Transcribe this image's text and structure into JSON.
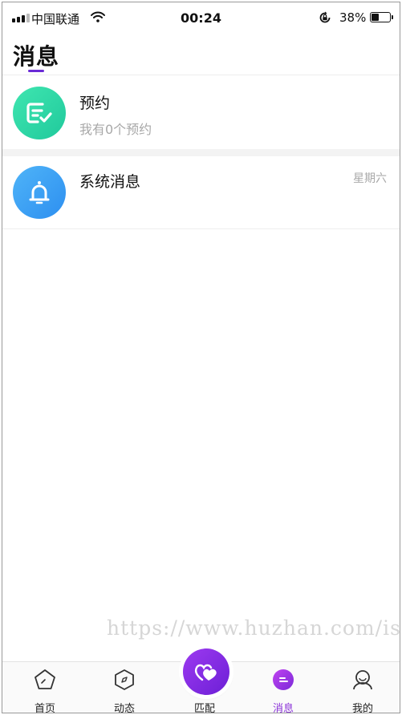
{
  "status_bar": {
    "carrier": "中国联通",
    "time": "00:24",
    "battery_percent": "38%",
    "battery_level": 0.38,
    "icons": [
      "signal-icon",
      "wifi-icon",
      "rotation-lock-icon",
      "battery-icon"
    ]
  },
  "header": {
    "title": "消息",
    "accent_color": "#6a2bd6"
  },
  "messages": [
    {
      "title": "预约",
      "subtitle": "我有0个预约",
      "time": "",
      "icon": "calendar-check-icon",
      "color": "#2fd6a6"
    },
    {
      "title": "系统消息",
      "subtitle": "",
      "time": "星期六",
      "icon": "bell-icon",
      "color": "#3a9ff4"
    }
  ],
  "watermark": "https://www.huzhan.com/ishc",
  "tabbar": {
    "active_color": "#8a32d8",
    "items": [
      {
        "label": "首页",
        "icon": "home-pentagon-icon"
      },
      {
        "label": "动态",
        "icon": "compass-icon"
      },
      {
        "label": "匹配",
        "icon": "hearts-icon"
      },
      {
        "label": "消息",
        "icon": "message-icon",
        "active": true
      },
      {
        "label": "我的",
        "icon": "profile-icon"
      }
    ]
  }
}
